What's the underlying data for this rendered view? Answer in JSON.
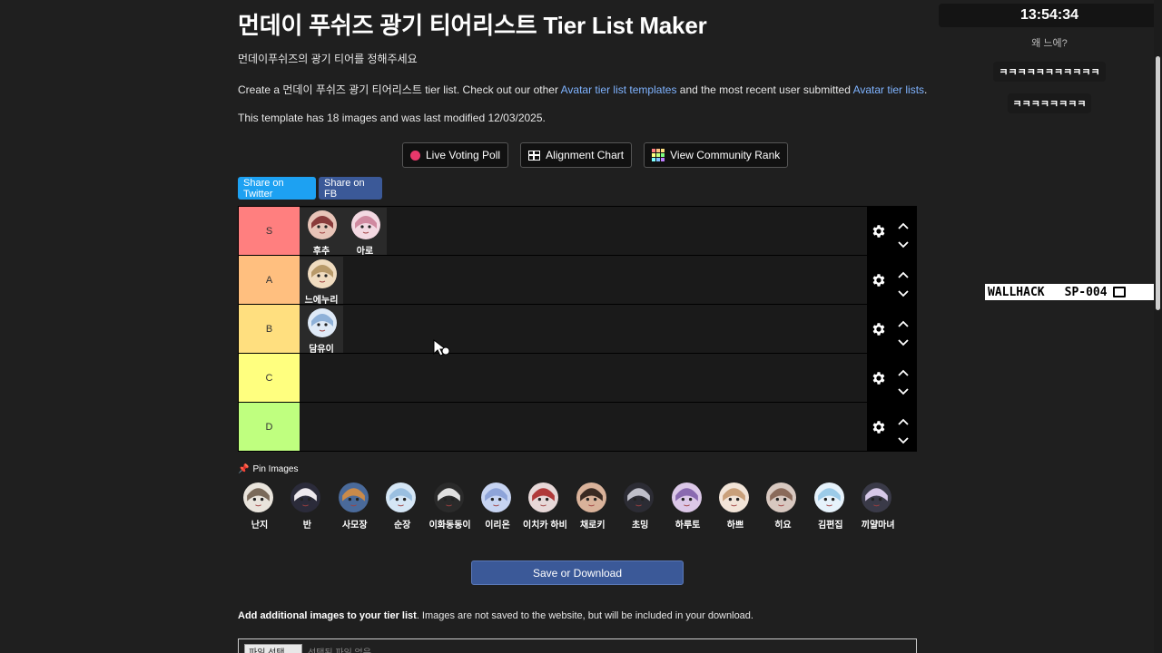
{
  "page": {
    "title": "먼데이 푸쉬즈 광기 티어리스트 Tier List Maker",
    "subtitle": "먼데이푸쉬즈의 광기 티어를 정해주세요",
    "create_prefix": "Create a 먼데이 푸쉬즈 광기 티어리스트 tier list. Check out our other ",
    "create_link1": "Avatar tier list templates",
    "create_middle": " and the most recent user submitted ",
    "create_link2": "Avatar tier lists",
    "create_suffix": ".",
    "template_info": "This template has 18 images and was last modified 12/03/2025."
  },
  "buttons": {
    "live_voting": "Live Voting Poll",
    "alignment": "Alignment Chart",
    "community_rank": "View Community Rank",
    "share_twitter": "Share on Twitter",
    "share_fb": "Share on FB",
    "save": "Save or Download"
  },
  "tiers": [
    {
      "label": "S",
      "color": "#ff7f7f",
      "items": [
        {
          "name": "후추",
          "bg": "#e8c4b8",
          "fg": "#8a3b3b"
        },
        {
          "name": "아로",
          "bg": "#f3d9e2",
          "fg": "#d08aa0"
        }
      ]
    },
    {
      "label": "A",
      "color": "#ffbf7f",
      "items": [
        {
          "name": "느에누리",
          "bg": "#f0dcc0",
          "fg": "#b89a6a"
        }
      ]
    },
    {
      "label": "B",
      "color": "#ffdf7f",
      "items": [
        {
          "name": "담유이",
          "bg": "#dfeaf7",
          "fg": "#8fb1d8"
        }
      ]
    },
    {
      "label": "C",
      "color": "#ffff7f",
      "items": []
    },
    {
      "label": "D",
      "color": "#bfff7f",
      "items": []
    }
  ],
  "pin_label": "Pin Images",
  "pool": [
    {
      "name": "난지",
      "bg": "#e9e4dc",
      "fg": "#7a6a5a"
    },
    {
      "name": "반",
      "bg": "#2b2b3a",
      "fg": "#ede9ee"
    },
    {
      "name": "사모장",
      "bg": "#4a6a9a",
      "fg": "#c98a4a"
    },
    {
      "name": "순장",
      "bg": "#d5e6f5",
      "fg": "#9abfe0"
    },
    {
      "name": "이화동동이",
      "bg": "#2a2a2a",
      "fg": "#e0e0e0"
    },
    {
      "name": "이리온",
      "bg": "#c7d4f2",
      "fg": "#8ea4d9"
    },
    {
      "name": "이치카 하비",
      "bg": "#e7d8d8",
      "fg": "#b03a3a"
    },
    {
      "name": "채로키",
      "bg": "#d9b29a",
      "fg": "#3a2a22"
    },
    {
      "name": "초밍",
      "bg": "#2c2c34",
      "fg": "#bfbfc9"
    },
    {
      "name": "하루토",
      "bg": "#dcc8e8",
      "fg": "#8a6ab0"
    },
    {
      "name": "하쁘",
      "bg": "#f2e4d8",
      "fg": "#c9a07a"
    },
    {
      "name": "히요",
      "bg": "#d8c8c0",
      "fg": "#8a6a5a"
    },
    {
      "name": "김편집",
      "bg": "#e6f2fb",
      "fg": "#9ccbe8"
    },
    {
      "name": "끼얄마녀",
      "bg": "#3a3a48",
      "fg": "#d6c8e8"
    }
  ],
  "add_images": {
    "bold": "Add additional images to your tier list",
    "rest": ". Images are not saved to the website, but will be included in your download.",
    "file_button": "파일 선택",
    "file_value": "선택된 파일 없음"
  },
  "overlay": {
    "clock": "13:54:34",
    "chat": [
      "왜 느에?",
      "ㅋㅋㅋㅋㅋㅋㅋㅋㅋㅋㅋ",
      "ㅋㅋㅋㅋㅋㅋㅋㅋ"
    ],
    "brand_left": "WALLHACK",
    "brand_right": "SP-004"
  },
  "colors": {
    "link": "#7fb3ff",
    "twitter": "#1da1f2",
    "facebook": "#3b5998",
    "live_dot": "#e8386b"
  }
}
